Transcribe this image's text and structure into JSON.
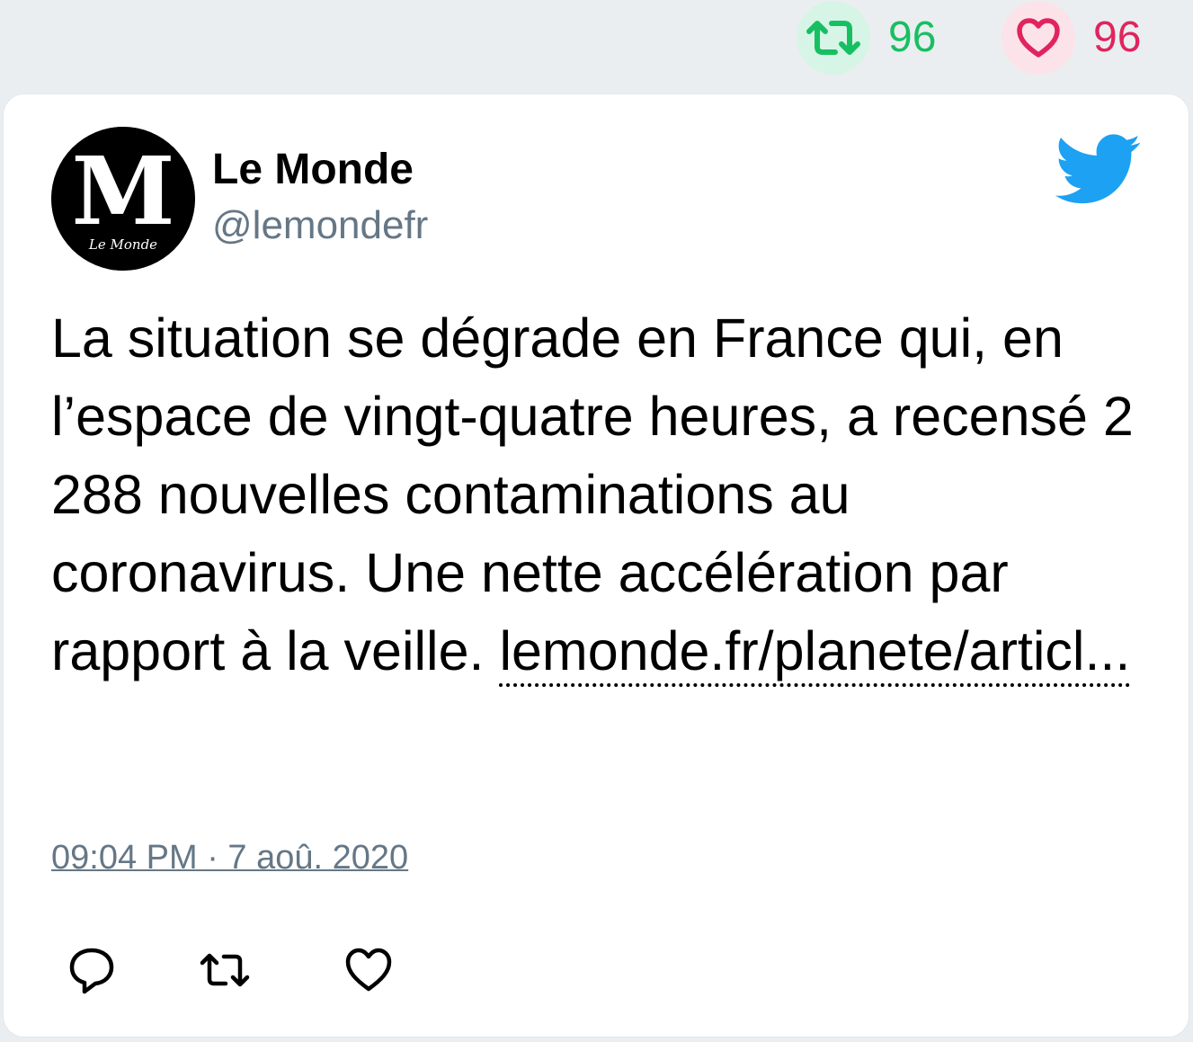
{
  "stats": {
    "retweets": "96",
    "likes": "96"
  },
  "colors": {
    "retweet": "#17bf63",
    "like": "#e0245e",
    "twitter_blue": "#1da1f2",
    "secondary_text": "#657786"
  },
  "author": {
    "name": "Le Monde",
    "handle": "@lemondefr",
    "avatar_logo_letter": "M",
    "avatar_logo_caption": "Le Monde"
  },
  "tweet": {
    "text": "La situation se dégrade en France qui, en l’espace de vingt-quatre heures, a recensé 2 288 nouvelles contaminations au coronavirus. Une nette accélération par rapport à la veille.",
    "link": "lemonde.fr/planete/articl...",
    "timestamp": "09:04 PM · 7 aoû. 2020"
  },
  "actions": [
    "reply-icon",
    "retweet-icon",
    "like-icon"
  ]
}
